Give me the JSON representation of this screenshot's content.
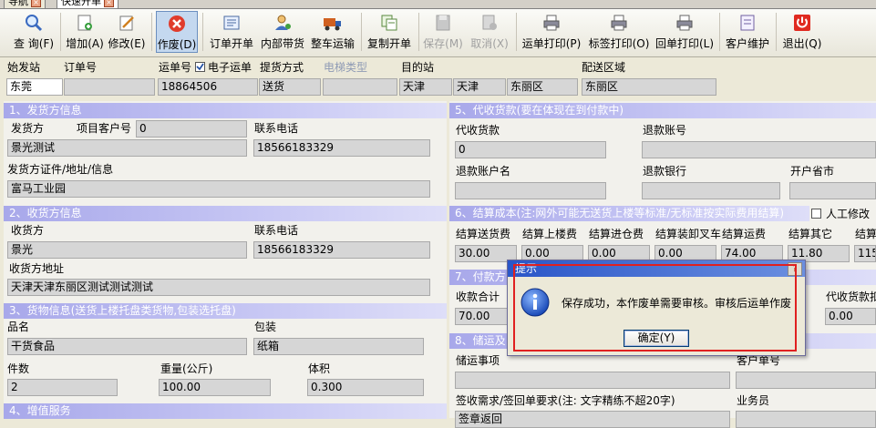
{
  "tabs": [
    {
      "label": "导航"
    },
    {
      "label": "快速开单"
    }
  ],
  "toolbar": {
    "items": [
      {
        "label": "查 询(F)",
        "icon": "search-icon"
      },
      {
        "label": "增加(A)",
        "icon": "add-doc-icon"
      },
      {
        "label": "修改(E)",
        "icon": "edit-icon"
      },
      {
        "label": "作废(D)",
        "icon": "void-icon"
      },
      {
        "label": "订单开单",
        "icon": "order-icon"
      },
      {
        "label": "内部带货",
        "icon": "person-icon"
      },
      {
        "label": "整车运输",
        "icon": "truck-icon"
      },
      {
        "label": "复制开单",
        "icon": "copy-icon"
      },
      {
        "label": "保存(M)",
        "icon": "save-icon"
      },
      {
        "label": "取消(X)",
        "icon": "cancel-icon"
      },
      {
        "label": "运单打印(P)",
        "icon": "printer-icon"
      },
      {
        "label": "标签打印(O)",
        "icon": "printer-icon"
      },
      {
        "label": "回单打印(L)",
        "icon": "printer-icon"
      },
      {
        "label": "客户维护",
        "icon": "customer-icon"
      },
      {
        "label": "退出(Q)",
        "icon": "power-icon"
      }
    ]
  },
  "header": {
    "start_station_label": "始发站",
    "start_station_value": "东莞",
    "order_no_label": "订单号",
    "order_no_value": "",
    "waybill_no_label": "运单号",
    "waybill_no_value": "18864506",
    "e_waybill_label": "电子运单",
    "pickup_label": "提货方式",
    "pickup_value": "送货",
    "elevator_label": "电梯类型",
    "elevator_value": "",
    "dest_label": "目的站",
    "dest_values": [
      "天津",
      "天津",
      "东丽区"
    ],
    "delivery_area_label": "配送区域",
    "delivery_area_value": "东丽区"
  },
  "shipper": {
    "title": "1、发货方信息",
    "name_label": "发货方",
    "project_no_label": "项目客户号",
    "project_no_value": "0",
    "phone_label": "联系电话",
    "name_value": "景光测试",
    "phone_value": "18566183329",
    "id_label": "发货方证件/地址/信息",
    "id_value": "富马工业园"
  },
  "consignee": {
    "title": "2、收货方信息",
    "name_label": "收货方",
    "phone_label": "联系电话",
    "name_value": "景光",
    "phone_value": "18566183329",
    "addr_label": "收货方地址",
    "addr_value": "天津天津东丽区测试测试测试"
  },
  "goods": {
    "title": "3、货物信息(送货上楼托盘类货物,包装选托盘)",
    "name_label": "品名",
    "name_value": "干货食品",
    "pack_label": "包装",
    "pack_value": "纸箱",
    "qty_label": "件数",
    "qty_value": "2",
    "weight_label": "重量(公斤)",
    "weight_value": "100.00",
    "volume_label": "体积",
    "volume_value": "0.300"
  },
  "value_added": {
    "title": "4、增值服务"
  },
  "cod": {
    "title": "5、代收货款(要在体现在到付款中)",
    "amount_label": "代收货款",
    "amount_value": "0",
    "refund_acct_label": "退款账号",
    "refund_name_label": "退款账户名",
    "refund_bank_label": "退款银行",
    "province_label": "开户省市"
  },
  "settle": {
    "title": "6、结算成本(注:网外可能无送货上楼等标准/无标准按实际费用结算)",
    "manual_label": "人工修改",
    "cols": [
      "结算送货费",
      "结算上楼费",
      "结算进仓费",
      "结算装卸叉车",
      "结算运费",
      "结算其它",
      "结算"
    ],
    "values": [
      "30.00",
      "0.00",
      "0.00",
      "0.00",
      "74.00",
      "11.80",
      "115"
    ]
  },
  "payment": {
    "title": "7、付款方",
    "total_label": "收款合计",
    "total_value": "70.00",
    "cod_label": "代收货款扣",
    "cod_value": "0.00"
  },
  "storage": {
    "title": "8、储运及",
    "notes_label": "储运事项",
    "no_label": "客户单号",
    "receipt_label": "签收需求/签回单要求(注: 文字精练不超20字)",
    "salesman_label": "业务员",
    "receipt_value": "签章返回"
  },
  "dialog": {
    "title": "提示",
    "message": "保存成功，本作废单需要审核。审核后运单作废",
    "ok_label": "确定(Y)"
  }
}
